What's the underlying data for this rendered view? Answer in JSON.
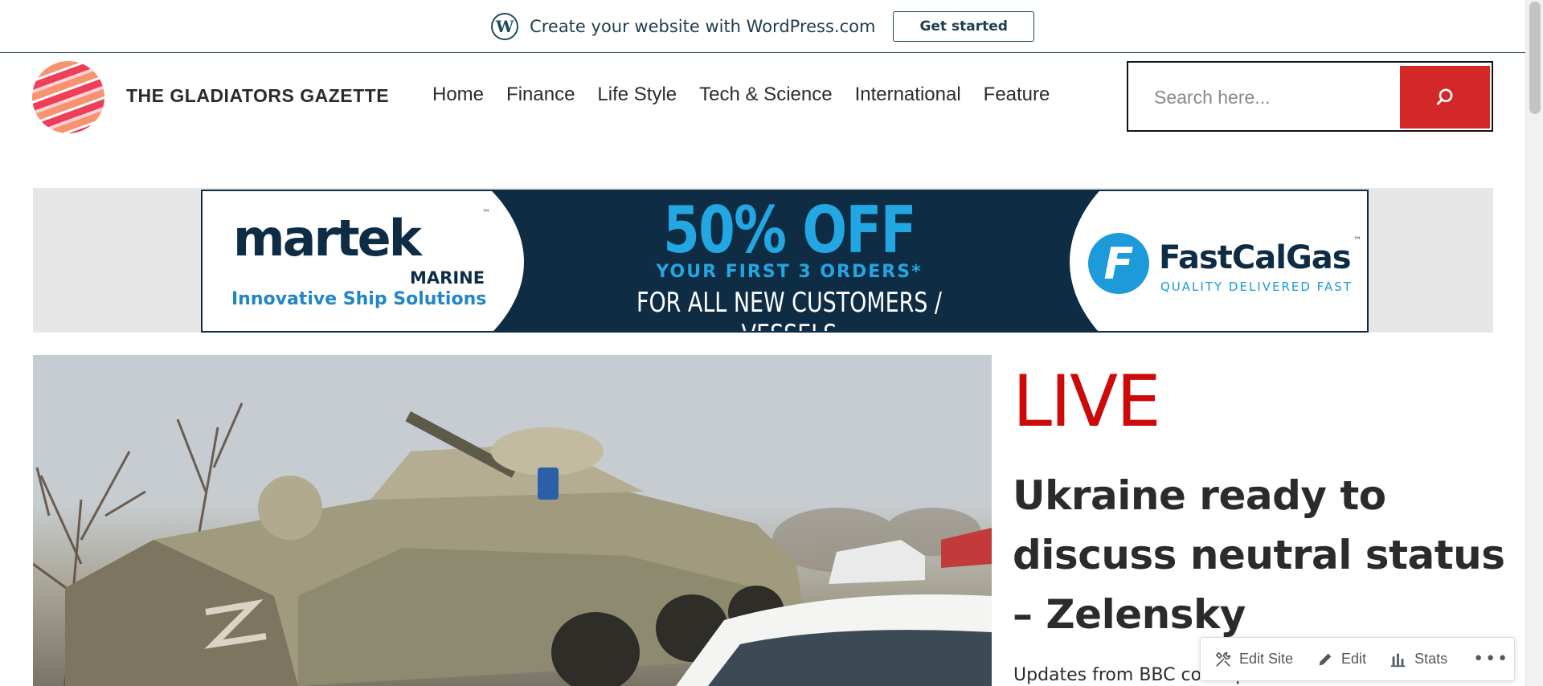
{
  "wp_banner": {
    "text": "Create your website with WordPress.com",
    "button_label": "Get started",
    "logo_letter": "W"
  },
  "header": {
    "site_title": "THE GLADIATORS GAZETTE",
    "nav": [
      "Home",
      "Finance",
      "Life Style",
      "Tech & Science",
      "International",
      "Feature"
    ],
    "search": {
      "placeholder": "Search here..."
    }
  },
  "ad": {
    "left_brand": "martek",
    "left_brand_sub": "MARINE",
    "left_tagline": "Innovative Ship Solutions",
    "tm": "™",
    "headline": "50% OFF",
    "sub1": "YOUR FIRST 3 ORDERS*",
    "sub2": "FOR ALL NEW CUSTOMERS / VESSELS",
    "right_brand": "FastCalGas",
    "right_badge": "F",
    "right_tagline": "QUALITY DELIVERED FAST",
    "colors": {
      "navy": "#0f2c45",
      "blue": "#22a7e2"
    }
  },
  "featured": {
    "live_label": "LIVE",
    "headline": "Ukraine ready to discuss neutral status – Zelensky",
    "excerpt": "Updates from BBC correspondents in Ukraine.",
    "live_color": "#cc0a0a"
  },
  "admin_bar": {
    "items": [
      {
        "label": "Edit Site",
        "icon": "tools-icon"
      },
      {
        "label": "Edit",
        "icon": "pencil-icon"
      },
      {
        "label": "Stats",
        "icon": "bar-chart-icon"
      }
    ],
    "more": "•••"
  },
  "colors": {
    "accent": "#d42828",
    "wp_blue": "#1e4a5e"
  }
}
